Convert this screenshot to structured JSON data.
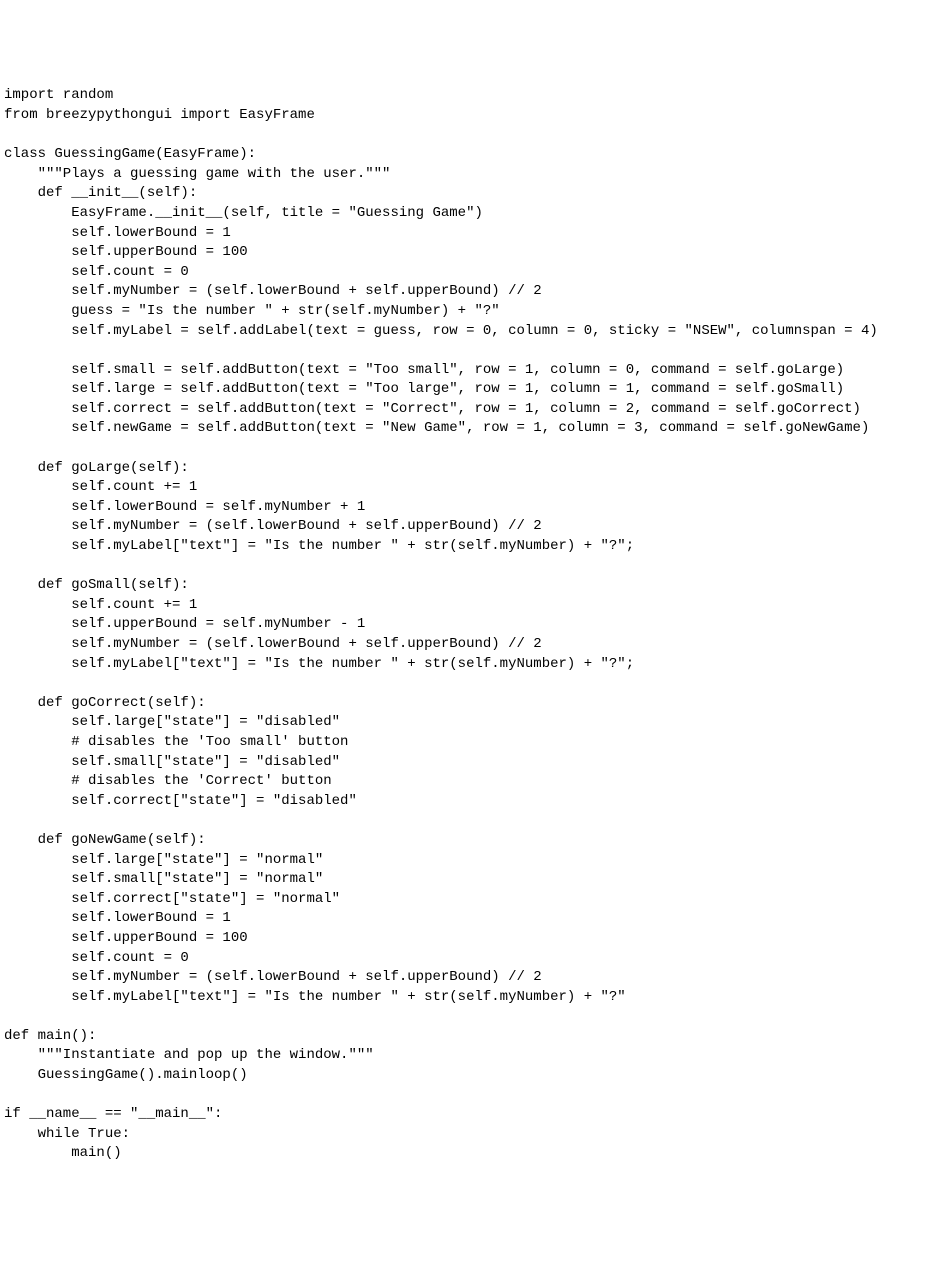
{
  "code": {
    "lines": [
      "import random",
      "from breezypythongui import EasyFrame",
      "",
      "class GuessingGame(EasyFrame):",
      "    \"\"\"Plays a guessing game with the user.\"\"\"",
      "    def __init__(self):",
      "        EasyFrame.__init__(self, title = \"Guessing Game\")",
      "        self.lowerBound = 1",
      "        self.upperBound = 100",
      "        self.count = 0",
      "        self.myNumber = (self.lowerBound + self.upperBound) // 2",
      "        guess = \"Is the number \" + str(self.myNumber) + \"?\"",
      "        self.myLabel = self.addLabel(text = guess, row = 0, column = 0, sticky = \"NSEW\", columnspan = 4)",
      "",
      "        self.small = self.addButton(text = \"Too small\", row = 1, column = 0, command = self.goLarge)",
      "        self.large = self.addButton(text = \"Too large\", row = 1, column = 1, command = self.goSmall)",
      "        self.correct = self.addButton(text = \"Correct\", row = 1, column = 2, command = self.goCorrect)",
      "        self.newGame = self.addButton(text = \"New Game\", row = 1, column = 3, command = self.goNewGame)",
      "",
      "    def goLarge(self):",
      "        self.count += 1",
      "        self.lowerBound = self.myNumber + 1",
      "        self.myNumber = (self.lowerBound + self.upperBound) // 2",
      "        self.myLabel[\"text\"] = \"Is the number \" + str(self.myNumber) + \"?\";",
      "",
      "    def goSmall(self):",
      "        self.count += 1",
      "        self.upperBound = self.myNumber - 1",
      "        self.myNumber = (self.lowerBound + self.upperBound) // 2",
      "        self.myLabel[\"text\"] = \"Is the number \" + str(self.myNumber) + \"?\";",
      "",
      "    def goCorrect(self):",
      "        self.large[\"state\"] = \"disabled\"",
      "        # disables the 'Too small' button",
      "        self.small[\"state\"] = \"disabled\"",
      "        # disables the 'Correct' button",
      "        self.correct[\"state\"] = \"disabled\"",
      "",
      "    def goNewGame(self):",
      "        self.large[\"state\"] = \"normal\"",
      "        self.small[\"state\"] = \"normal\"",
      "        self.correct[\"state\"] = \"normal\"",
      "        self.lowerBound = 1",
      "        self.upperBound = 100",
      "        self.count = 0",
      "        self.myNumber = (self.lowerBound + self.upperBound) // 2",
      "        self.myLabel[\"text\"] = \"Is the number \" + str(self.myNumber) + \"?\"",
      "",
      "def main():",
      "    \"\"\"Instantiate and pop up the window.\"\"\"",
      "    GuessingGame().mainloop()",
      "",
      "if __name__ == \"__main__\":",
      "    while True:",
      "        main()"
    ]
  }
}
